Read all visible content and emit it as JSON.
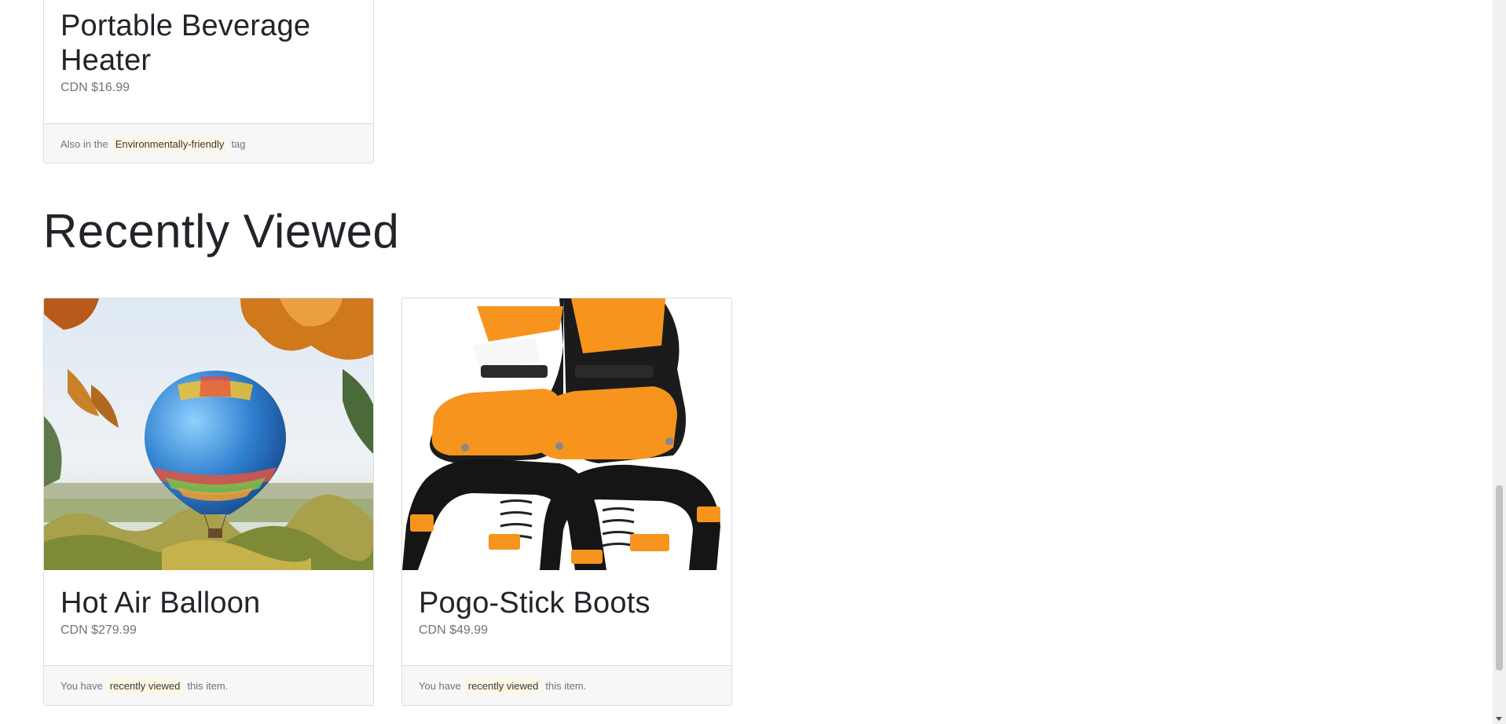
{
  "top_card": {
    "title": "Portable Beverage Heater",
    "price": "CDN $16.99",
    "footer_prefix": "Also in the",
    "footer_tag": "Environmentally-friendly",
    "footer_suffix": "tag"
  },
  "recently_viewed": {
    "heading": "Recently Viewed",
    "cards": [
      {
        "title": "Hot Air Balloon",
        "price": "CDN $279.99",
        "image_alt": "hot-air-balloon-image",
        "footer_prefix": "You have",
        "footer_tag": "recently viewed",
        "footer_suffix": "this item."
      },
      {
        "title": "Pogo-Stick Boots",
        "price": "CDN $49.99",
        "image_alt": "pogo-stick-boots-image",
        "footer_prefix": "You have",
        "footer_tag": "recently viewed",
        "footer_suffix": "this item."
      }
    ]
  },
  "colors": {
    "tag_highlight": "#fdf6e1",
    "muted_text": "#6c757d",
    "border": "#dcdcdc",
    "footer_bg": "#f7f7f7",
    "accent_orange": "#f7941d"
  }
}
